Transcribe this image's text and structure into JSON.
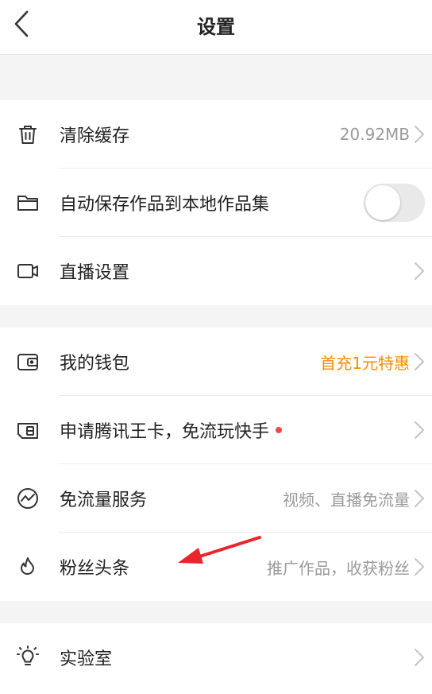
{
  "header": {
    "title": "设置",
    "back_icon": "chevron-left-icon"
  },
  "section1": {
    "items": [
      {
        "icon": "trash-icon",
        "label": "清除缓存",
        "value": "20.92MB"
      },
      {
        "icon": "folder-icon",
        "label": "自动保存作品到本地作品集",
        "toggle_on": false
      },
      {
        "icon": "video-camera-icon",
        "label": "直播设置"
      }
    ]
  },
  "section2": {
    "items": [
      {
        "icon": "wallet-icon",
        "label": "我的钱包",
        "value": "首充1元特惠",
        "value_color": "#ff8a00"
      },
      {
        "icon": "sim-card-icon",
        "label": "申请腾讯王卡，免流玩快手",
        "badge_color": "#f24747"
      },
      {
        "icon": "data-wave-icon",
        "label": "免流量服务",
        "value": "视频、直播免流量"
      },
      {
        "icon": "flame-icon",
        "label": "粉丝头条",
        "value": "推广作品，收获粉丝"
      }
    ]
  },
  "section3": {
    "items": [
      {
        "icon": "lightbulb-icon",
        "label": "实验室"
      }
    ]
  },
  "annotation": {
    "icon": "red-arrow-annotation",
    "color": "#e8262b"
  }
}
